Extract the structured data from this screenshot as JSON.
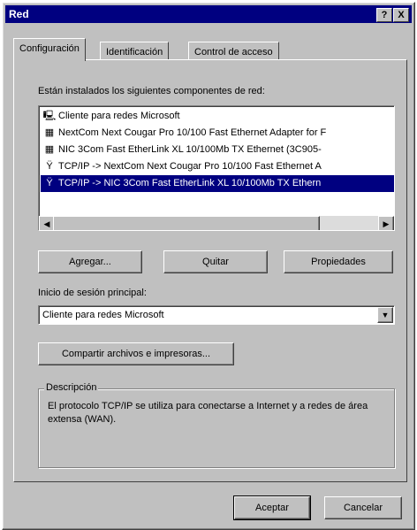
{
  "window": {
    "title": "Red"
  },
  "title_buttons": {
    "help": "?",
    "close": "X"
  },
  "tabs": [
    {
      "label": "Configuración"
    },
    {
      "label": "Identificación"
    },
    {
      "label": "Control de acceso"
    }
  ],
  "components": {
    "label": "Están instalados los siguientes componentes de red:",
    "items": [
      {
        "label": "Cliente para redes Microsoft",
        "icon": "network-client-icon",
        "selected": false
      },
      {
        "label": "NextCom Next Cougar Pro 10/100 Fast Ethernet Adapter for F",
        "icon": "network-adapter-icon",
        "selected": false
      },
      {
        "label": "NIC 3Com Fast EtherLink XL 10/100Mb TX Ethernet (3C905-",
        "icon": "network-adapter-icon",
        "selected": false
      },
      {
        "label": "TCP/IP -> NextCom Next Cougar Pro 10/100 Fast Ethernet A",
        "icon": "protocol-icon",
        "selected": false
      },
      {
        "label": "TCP/IP -> NIC 3Com Fast EtherLink XL 10/100Mb TX Ethern",
        "icon": "protocol-icon",
        "selected": true
      }
    ]
  },
  "buttons": {
    "add": "Agregar...",
    "remove": "Quitar",
    "properties": "Propiedades",
    "share": "Compartir archivos e impresoras...",
    "ok": "Aceptar",
    "cancel": "Cancelar"
  },
  "logon": {
    "label": "Inicio de sesión principal:",
    "value": "Cliente para redes Microsoft"
  },
  "description": {
    "title": "Descripción",
    "text": "El protocolo TCP/IP se utiliza para conectarse a Internet y a redes de área extensa (WAN)."
  },
  "colors": {
    "titlebar": "#000080",
    "face": "#c0c0c0",
    "selection": "#000080"
  }
}
